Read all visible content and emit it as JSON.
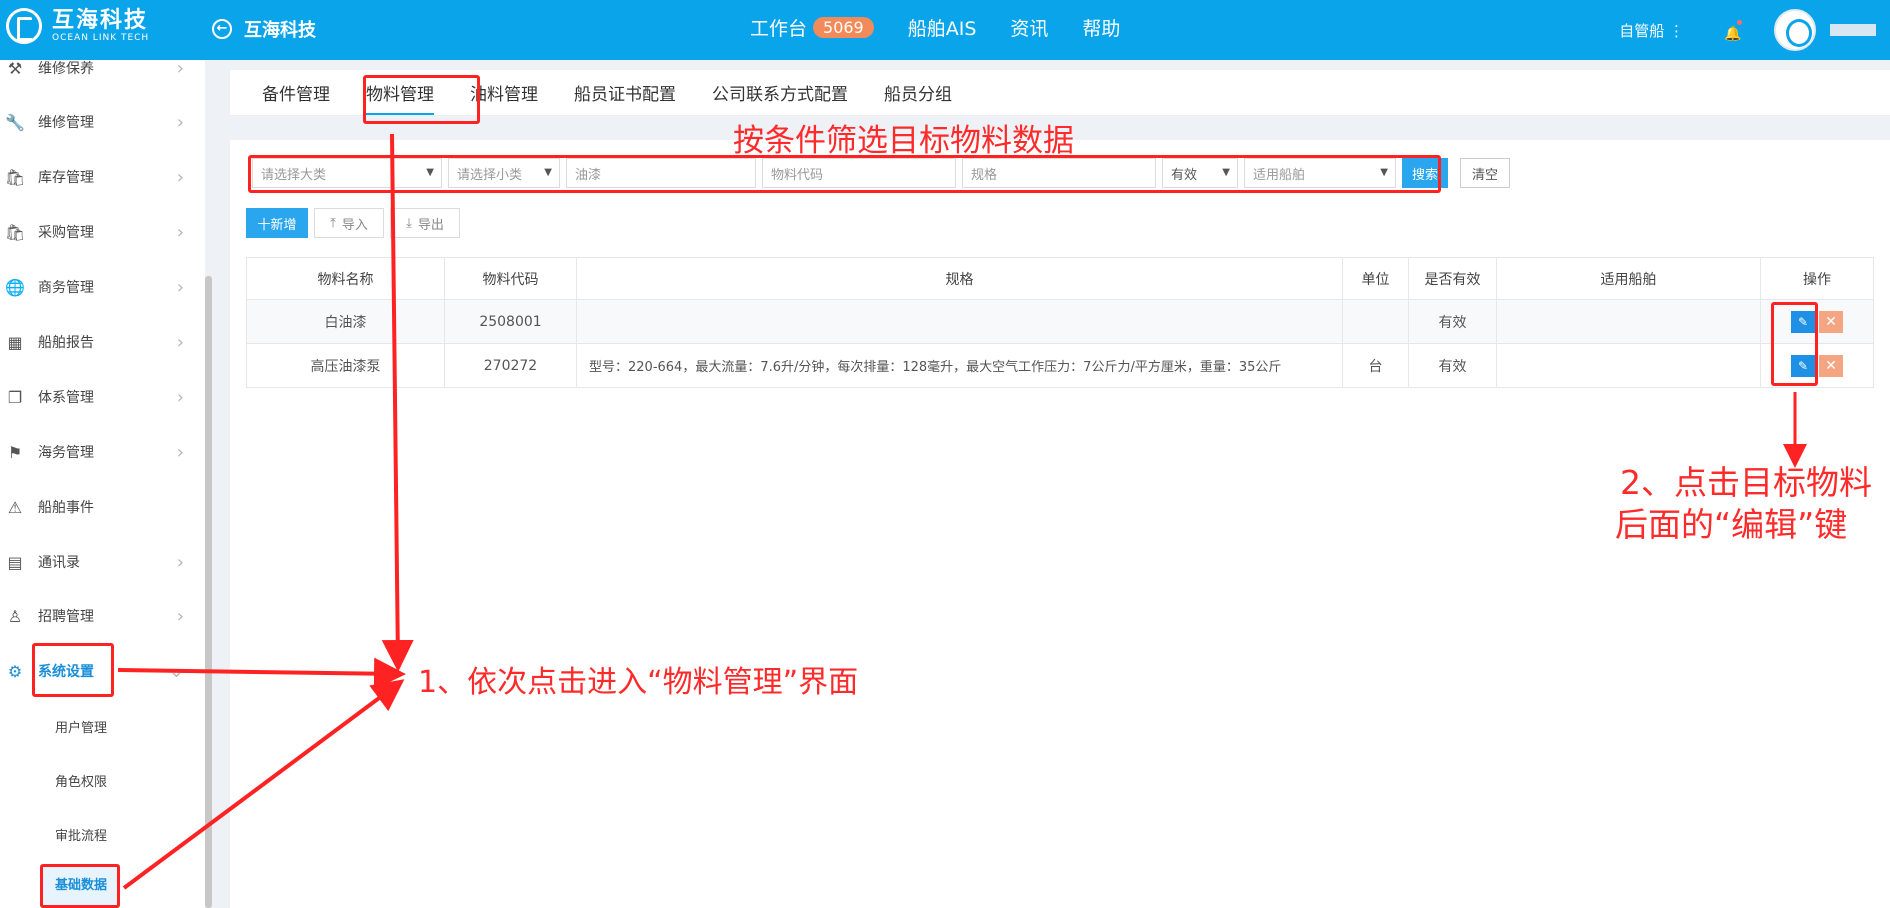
{
  "topbar": {
    "logo_cn": "互海科技",
    "logo_en": "OCEAN LINK TECH",
    "back_title": "互海科技",
    "nav": [
      {
        "label": "工作台",
        "badge": "5069"
      },
      {
        "label": "船舶AIS"
      },
      {
        "label": "资讯"
      },
      {
        "label": "帮助"
      }
    ],
    "ship_selector": "自管船 ⋮",
    "accent": "#0aa4ea"
  },
  "sidebar": {
    "items": [
      {
        "label": "维修保养",
        "icon": "hammer-icon",
        "glyph": "⚒"
      },
      {
        "label": "维修管理",
        "icon": "wrench-icon",
        "glyph": "🔧"
      },
      {
        "label": "库存管理",
        "icon": "bag-icon",
        "glyph": "🛍"
      },
      {
        "label": "采购管理",
        "icon": "bag-icon",
        "glyph": "🛍"
      },
      {
        "label": "商务管理",
        "icon": "globe-icon",
        "glyph": "🌐"
      },
      {
        "label": "船舶报告",
        "icon": "calendar-icon",
        "glyph": "▦"
      },
      {
        "label": "体系管理",
        "icon": "document-icon",
        "glyph": "❐"
      },
      {
        "label": "海务管理",
        "icon": "signpost-icon",
        "glyph": "⚑"
      },
      {
        "label": "船舶事件",
        "icon": "warning-icon",
        "glyph": "⚠"
      },
      {
        "label": "通讯录",
        "icon": "server-icon",
        "glyph": "▤"
      },
      {
        "label": "招聘管理",
        "icon": "user-icon",
        "glyph": "♙"
      },
      {
        "label": "系统设置",
        "icon": "gear-icon",
        "glyph": "⚙"
      }
    ],
    "sub_items": [
      "用户管理",
      "角色权限",
      "审批流程",
      "基础数据"
    ]
  },
  "tabs": [
    "备件管理",
    "物料管理",
    "油料管理",
    "船员证书配置",
    "公司联系方式配置",
    "船员分组"
  ],
  "filters": {
    "category": "请选择大类",
    "subcategory": "请选择小类",
    "name": "油漆",
    "code_placeholder": "物料代码",
    "spec_placeholder": "规格",
    "valid": "有效",
    "ship": "适用船舶",
    "search": "搜索",
    "clear": "清空"
  },
  "toolbar": {
    "add": "十新增",
    "import": "导入",
    "export": "导出"
  },
  "table": {
    "headers": [
      "物料名称",
      "物料代码",
      "规格",
      "单位",
      "是否有效",
      "适用船舶",
      "操作"
    ],
    "rows": [
      {
        "name": "白油漆",
        "code": "2508001",
        "spec": "",
        "unit": "",
        "valid": "有效",
        "ship": ""
      },
      {
        "name": "高压油漆泵",
        "code": "270272",
        "spec": "型号：220-664，最大流量：7.6升/分钟，每次排量：128毫升，最大空气工作压力：7公斤力/平方厘米，重量：35公斤",
        "unit": "台",
        "valid": "有效",
        "ship": ""
      }
    ]
  },
  "annotations": {
    "filter_note": "按条件筛选目标物料数据",
    "step1": "1、依次点击进入“物料管理”界面",
    "step2_line1": "2、点击目标物料",
    "step2_line2": "后面的“编辑”键"
  }
}
